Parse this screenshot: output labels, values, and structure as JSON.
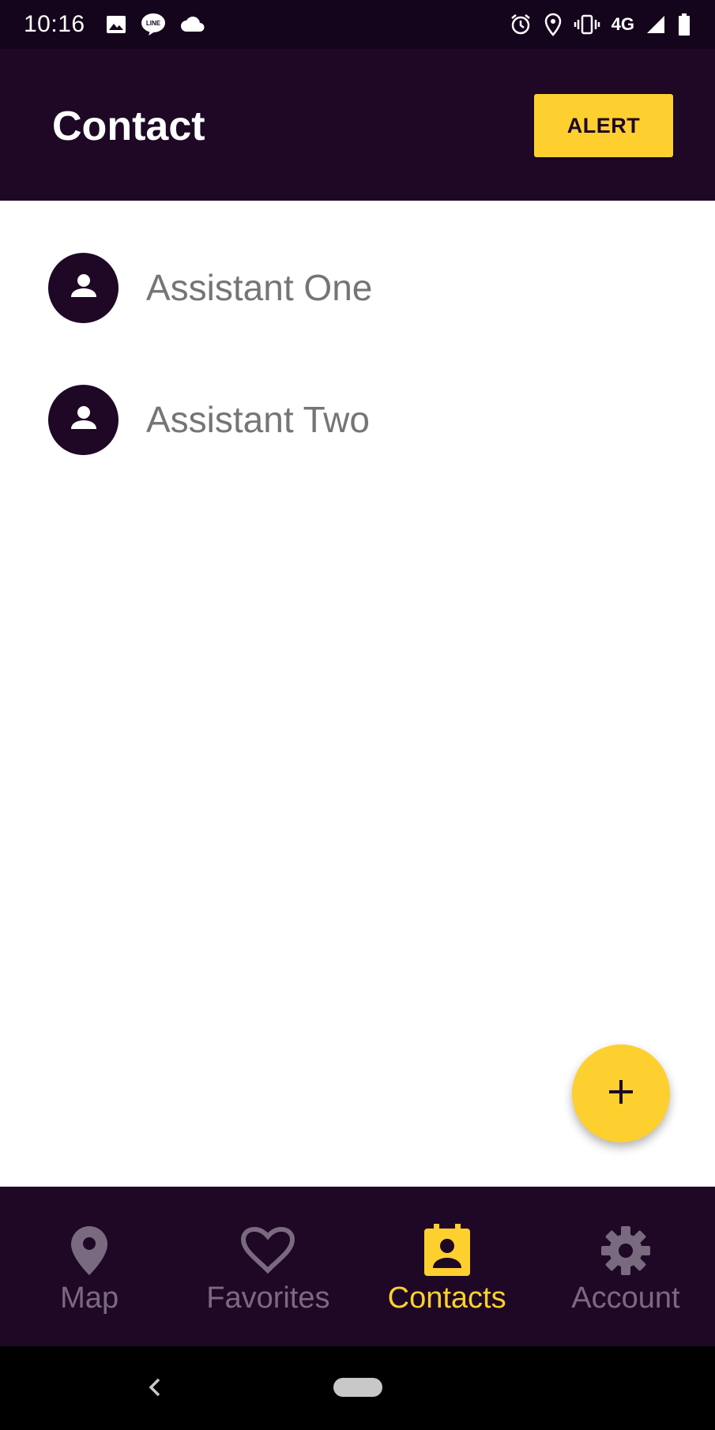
{
  "status_bar": {
    "time": "10:16",
    "network": "4G",
    "icons": [
      "image-icon",
      "line-icon",
      "cloud-icon",
      "alarm-icon",
      "location-icon",
      "vibrate-icon",
      "signal-icon",
      "battery-icon"
    ]
  },
  "app_bar": {
    "title": "Contact",
    "alert_label": "ALERT"
  },
  "contacts": [
    {
      "name": "Assistant One",
      "icon": "person-icon"
    },
    {
      "name": "Assistant Two",
      "icon": "person-icon"
    }
  ],
  "fab": {
    "icon": "plus-icon"
  },
  "bottom_nav": {
    "items": [
      {
        "label": "Map",
        "icon": "map-pin-icon",
        "active": false
      },
      {
        "label": "Favorites",
        "icon": "heart-icon",
        "active": false
      },
      {
        "label": "Contacts",
        "icon": "contacts-icon",
        "active": true
      },
      {
        "label": "Account",
        "icon": "gear-icon",
        "active": false
      }
    ]
  },
  "colors": {
    "primary_dark": "#1e0826",
    "status_bar": "#14041c",
    "accent": "#fdd02f",
    "inactive": "#7a6a80",
    "contact_text": "#757575"
  }
}
